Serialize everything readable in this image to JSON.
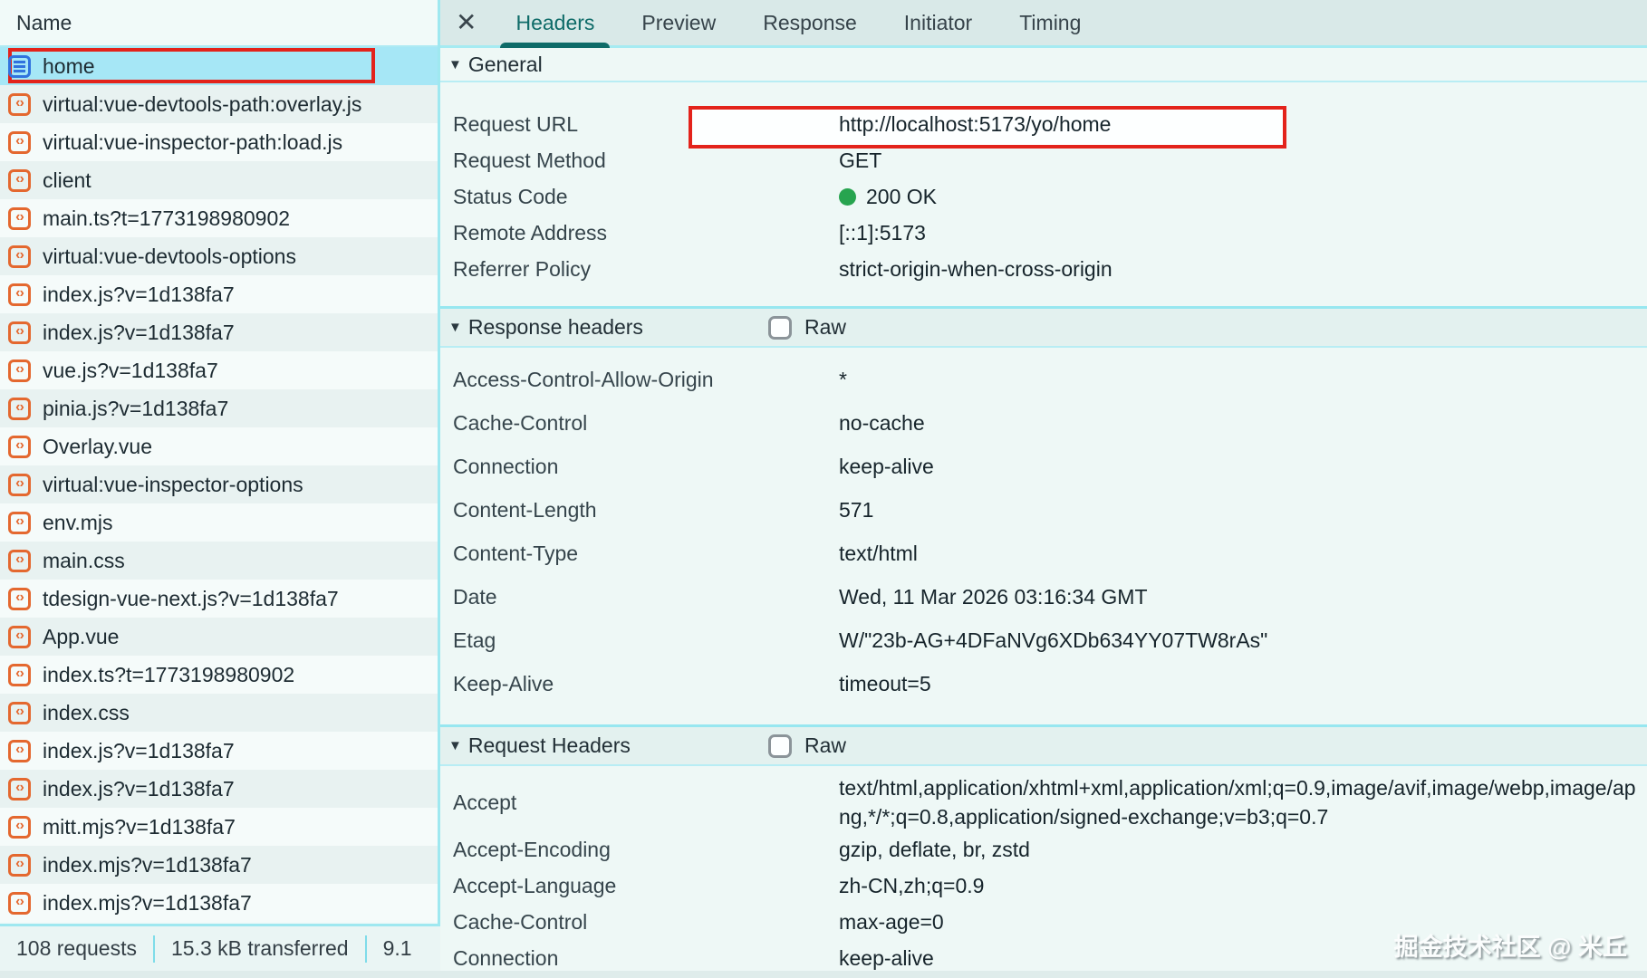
{
  "colors": {
    "accent_teal": "#0e6b68",
    "cyan_border": "#9fe8f0",
    "selected_row": "#a6e7f6",
    "annotation_red": "#e3231b",
    "status_green": "#27a44f",
    "script_icon_orange": "#e4682f",
    "document_icon_blue": "#3173de",
    "tabbar_bg": "#d9e9e8",
    "content_bg": "#eef8f6"
  },
  "icons": {
    "close": "✕",
    "section_collapse": "▼",
    "script_glyph": "‹›"
  },
  "sidebar": {
    "column_header": "Name",
    "items": [
      {
        "label": "home",
        "icon": "document",
        "selected": true
      },
      {
        "label": "virtual:vue-devtools-path:overlay.js",
        "icon": "script",
        "glyph": "‹›"
      },
      {
        "label": "virtual:vue-inspector-path:load.js",
        "icon": "script",
        "glyph": "‹›"
      },
      {
        "label": "client",
        "icon": "script",
        "glyph": "‹›"
      },
      {
        "label": "main.ts?t=1773198980902",
        "icon": "script",
        "glyph": "‹›"
      },
      {
        "label": "virtual:vue-devtools-options",
        "icon": "script",
        "glyph": "‹›"
      },
      {
        "label": "index.js?v=1d138fa7",
        "icon": "script",
        "glyph": "‹›"
      },
      {
        "label": "index.js?v=1d138fa7",
        "icon": "script",
        "glyph": "‹›"
      },
      {
        "label": "vue.js?v=1d138fa7",
        "icon": "script",
        "glyph": "‹›"
      },
      {
        "label": "pinia.js?v=1d138fa7",
        "icon": "script",
        "glyph": "‹›"
      },
      {
        "label": "Overlay.vue",
        "icon": "script",
        "glyph": "‹›"
      },
      {
        "label": "virtual:vue-inspector-options",
        "icon": "script",
        "glyph": "‹›"
      },
      {
        "label": "env.mjs",
        "icon": "script",
        "glyph": "‹›"
      },
      {
        "label": "main.css",
        "icon": "script",
        "glyph": "‹›"
      },
      {
        "label": "tdesign-vue-next.js?v=1d138fa7",
        "icon": "script",
        "glyph": "‹›"
      },
      {
        "label": "App.vue",
        "icon": "script",
        "glyph": "‹›"
      },
      {
        "label": "index.ts?t=1773198980902",
        "icon": "script",
        "glyph": "‹›"
      },
      {
        "label": "index.css",
        "icon": "script",
        "glyph": "‹›"
      },
      {
        "label": "index.js?v=1d138fa7",
        "icon": "script",
        "glyph": "‹›"
      },
      {
        "label": "index.js?v=1d138fa7",
        "icon": "script",
        "glyph": "‹›"
      },
      {
        "label": "mitt.mjs?v=1d138fa7",
        "icon": "script",
        "glyph": "‹›"
      },
      {
        "label": "index.mjs?v=1d138fa7",
        "icon": "script",
        "glyph": "‹›"
      },
      {
        "label": "index.mjs?v=1d138fa7",
        "icon": "script",
        "glyph": "‹›"
      }
    ],
    "status_bar": {
      "requests": "108 requests",
      "transferred": "15.3 kB transferred",
      "resources_truncated": "9.1"
    }
  },
  "panel": {
    "tabs": [
      {
        "label": "Headers",
        "active": true
      },
      {
        "label": "Preview"
      },
      {
        "label": "Response"
      },
      {
        "label": "Initiator"
      },
      {
        "label": "Timing"
      }
    ],
    "sections": {
      "general": {
        "title": "General",
        "rows": [
          {
            "name": "Request URL",
            "value": "http://localhost:5173/yo/home",
            "highlight_box": true
          },
          {
            "name": "Request Method",
            "value": "GET"
          },
          {
            "name": "Status Code",
            "value": "200 OK",
            "status_dot": true
          },
          {
            "name": "Remote Address",
            "value": "[::1]:5173"
          },
          {
            "name": "Referrer Policy",
            "value": "strict-origin-when-cross-origin"
          }
        ]
      },
      "response_headers": {
        "title": "Response headers",
        "raw_label": "Raw",
        "raw_checked": false,
        "rows": [
          {
            "name": "Access-Control-Allow-Origin",
            "value": "*"
          },
          {
            "name": "Cache-Control",
            "value": "no-cache"
          },
          {
            "name": "Connection",
            "value": "keep-alive"
          },
          {
            "name": "Content-Length",
            "value": "571"
          },
          {
            "name": "Content-Type",
            "value": "text/html"
          },
          {
            "name": "Date",
            "value": "Wed, 11 Mar 2026 03:16:34 GMT"
          },
          {
            "name": "Etag",
            "value": "W/\"23b-AG+4DFaNVg6XDb634YY07TW8rAs\""
          },
          {
            "name": "Keep-Alive",
            "value": "timeout=5"
          }
        ]
      },
      "request_headers": {
        "title": "Request Headers",
        "raw_label": "Raw",
        "raw_checked": false,
        "rows": [
          {
            "name": "Accept",
            "value": "text/html,application/xhtml+xml,application/xml;q=0.9,image/avif,image/webp,image/apng,*/*;q=0.8,application/signed-exchange;v=b3;q=0.7"
          },
          {
            "name": "Accept-Encoding",
            "value": "gzip, deflate, br, zstd"
          },
          {
            "name": "Accept-Language",
            "value": "zh-CN,zh;q=0.9"
          },
          {
            "name": "Cache-Control",
            "value": "max-age=0"
          },
          {
            "name": "Connection",
            "value": "keep-alive"
          }
        ]
      }
    }
  },
  "watermark": "掘金技术社区 @ 米丘"
}
